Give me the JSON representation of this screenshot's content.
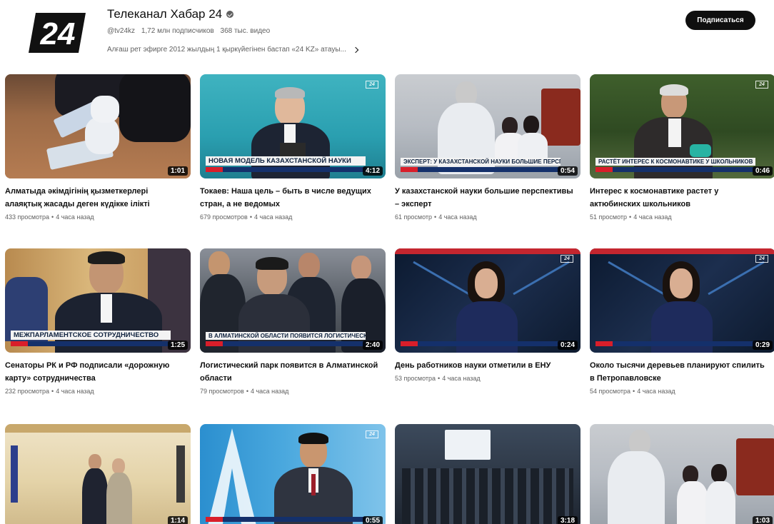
{
  "channel": {
    "logo_text": "24",
    "name": "Телеканал Хабар 24",
    "handle": "@tv24kz",
    "subscribers": "1,72 млн подписчиков",
    "videos_count": "368 тыс. видео",
    "description": "Алғаш рет эфирге 2012 жылдың 1 қыркүйегінен бастап «24 KZ» атауы...",
    "subscribe_label": "Подписаться"
  },
  "colors": {
    "subscribe_bg": "#0f0f0f",
    "meta_text": "#606060",
    "ticker_red": "#d91e2a",
    "ticker_blue": "#14306b"
  },
  "videos": [
    {
      "title": "Алматыда әкімдігінің қызметкерлері алаяқтық жасады деген күдікке ілікті",
      "views": "433 просмотра",
      "age": "4 часа назад",
      "duration": "1:01",
      "lower_third": ""
    },
    {
      "title": "Токаев: Наша цель – быть в числе ведущих стран, а не ведомых",
      "views": "679 просмотров",
      "age": "4 часа назад",
      "duration": "4:12",
      "lower_third": "НОВАЯ МОДЕЛЬ КАЗАХСТАНСКОЙ НАУКИ"
    },
    {
      "title": "У казахстанской науки большие перспективы – эксперт",
      "views": "61 просмотр",
      "age": "4 часа назад",
      "duration": "0:54",
      "lower_third": "ЭКСПЕРТ: У КАЗАХСТАНСКОЙ НАУКИ БОЛЬШИЕ ПЕРСПЕКТИВЫ"
    },
    {
      "title": "Интерес к космонавтике растет у актюбинских школьников",
      "views": "51 просмотр",
      "age": "4 часа назад",
      "duration": "0:46",
      "lower_third": "РАСТЁТ ИНТЕРЕС К КОСМОНАВТИКЕ У ШКОЛЬНИКОВ"
    },
    {
      "title": "Сенаторы РК и РФ подписали «дорожную карту» сотрудничества",
      "views": "232 просмотра",
      "age": "4 часа назад",
      "duration": "1:25",
      "lower_third": "МЕЖПАРЛАМЕНТСКОЕ СОТРУДНИЧЕСТВО"
    },
    {
      "title": "Логистический парк появится в Алматинской области",
      "views": "79 просмотров",
      "age": "4 часа назад",
      "duration": "2:40",
      "lower_third": "В АЛМАТИНСКОЙ ОБЛАСТИ ПОЯВИТСЯ ЛОГИСТИЧЕСКИЙ ПАРК"
    },
    {
      "title": "День работников науки отметили в ЕНУ",
      "views": "53 просмотра",
      "age": "4 часа назад",
      "duration": "0:24",
      "lower_third": ""
    },
    {
      "title": "Около тысячи деревьев планируют спилить в Петропавловске",
      "views": "54 просмотра",
      "age": "4 часа назад",
      "duration": "0:29",
      "lower_third": ""
    },
    {
      "title": "",
      "views": "",
      "age": "",
      "duration": "1:14",
      "lower_third": ""
    },
    {
      "title": "",
      "views": "",
      "age": "",
      "duration": "0:55",
      "lower_third": ""
    },
    {
      "title": "",
      "views": "",
      "age": "",
      "duration": "3:18",
      "lower_third": ""
    },
    {
      "title": "",
      "views": "",
      "age": "",
      "duration": "1:03",
      "lower_third": ""
    }
  ]
}
